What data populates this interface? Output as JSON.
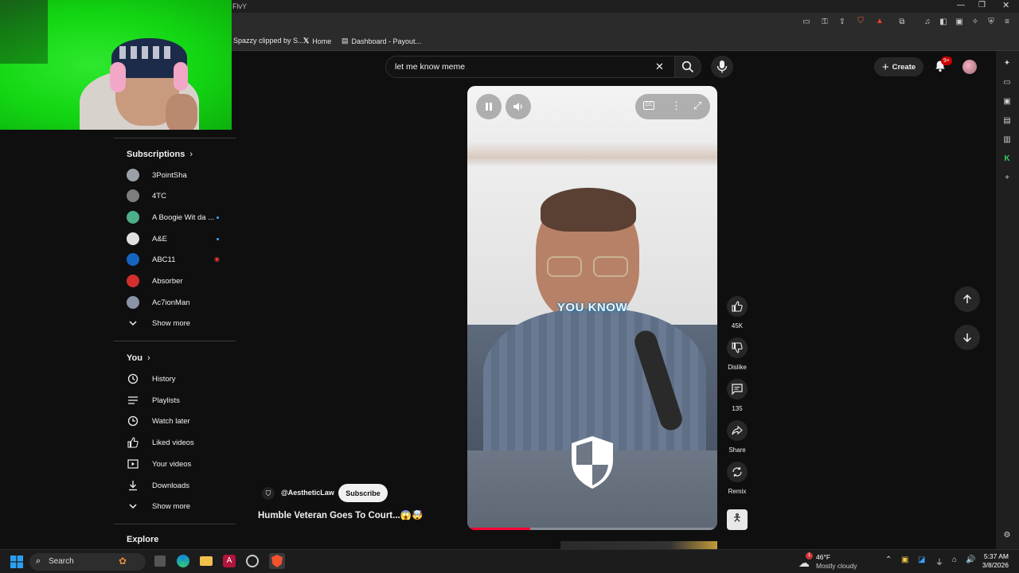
{
  "browser": {
    "tab_title_fragment": "FlvY",
    "bookmarks": [
      {
        "label": "Spazzy clipped by S..."
      },
      {
        "label": "Home"
      },
      {
        "label": "Dashboard - Payout..."
      }
    ]
  },
  "header": {
    "search_query": "let me know meme",
    "create_label": "Create",
    "notification_count": "9+"
  },
  "sidebar": {
    "subscriptions_title": "Subscriptions",
    "subscriptions": [
      {
        "label": "3PointSha",
        "color": "#9aa0a6",
        "new": false
      },
      {
        "label": "4TC",
        "color": "#7d7d7d",
        "new": false
      },
      {
        "label": "A Boogie Wit da ...",
        "color": "#4caf8a",
        "new": true
      },
      {
        "label": "A&E",
        "color": "#e0e0e0",
        "new": true
      },
      {
        "label": "ABC11",
        "color": "#1565c0",
        "new": true,
        "live": true
      },
      {
        "label": "Absorber",
        "color": "#d32f2f",
        "new": false
      },
      {
        "label": "Ac7ionMan",
        "color": "#8b93a8",
        "new": false
      }
    ],
    "subscriptions_more": "Show more",
    "you_title": "You",
    "you_items": [
      {
        "label": "History",
        "icon": "history-icon"
      },
      {
        "label": "Playlists",
        "icon": "playlists-icon"
      },
      {
        "label": "Watch later",
        "icon": "watch-later-icon"
      },
      {
        "label": "Liked videos",
        "icon": "thumbs-up-icon"
      },
      {
        "label": "Your videos",
        "icon": "your-videos-icon"
      },
      {
        "label": "Downloads",
        "icon": "download-icon"
      }
    ],
    "you_more": "Show more",
    "explore_title": "Explore"
  },
  "short": {
    "caption": "YOU KNOW",
    "channel": "@AestheticLaw",
    "subscribe_label": "Subscribe",
    "title": "Humble Veteran Goes To Court...😱🤯",
    "likes": "45K",
    "dislike_label": "Dislike",
    "comments": "135",
    "share_label": "Share",
    "remix_label": "Remix",
    "progress_fraction": 0.25
  },
  "taskbar": {
    "search_label": "Search",
    "weather_temp": "46°F",
    "weather_desc": "Mostly cloudy",
    "weather_badge": "1",
    "time": "5:37 AM",
    "date": "3/8/2026"
  }
}
